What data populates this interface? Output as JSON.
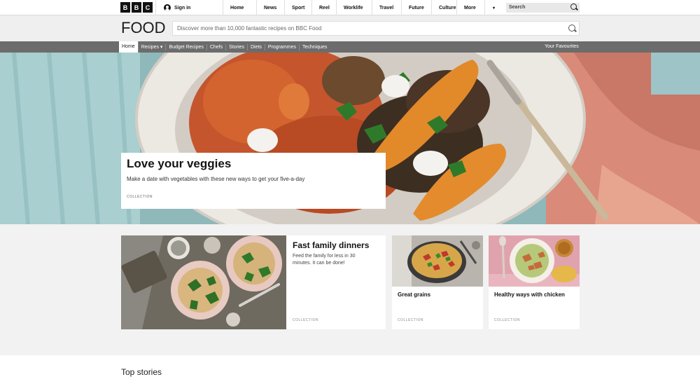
{
  "masthead": {
    "logo_letters": [
      "B",
      "B",
      "C"
    ],
    "signin": "Sign in",
    "nav": [
      "Home",
      "News",
      "Sport",
      "Reel",
      "Worklife",
      "Travel",
      "Future",
      "Culture",
      "More"
    ],
    "more_arrow": "▾",
    "search_placeholder": "Search"
  },
  "food_header": {
    "logo": "FOOD",
    "search_placeholder": "Discover more than 10,000 fantastic recipes on BBC Food"
  },
  "food_nav": {
    "items": [
      "Home",
      "Recipes ▾",
      "Budget Recipes",
      "Chefs",
      "Stories",
      "Diets",
      "Programmes",
      "Techniques"
    ],
    "favourites": "Your Favourites"
  },
  "hero": {
    "title": "Love your veggies",
    "description": "Make a date with vegetables with these new ways to get your five-a-day",
    "tag": "COLLECTION"
  },
  "cards": [
    {
      "title": "Fast family dinners",
      "description": "Feed the family for less in 30 minutes. It can be done!",
      "tag": "COLLECTION"
    },
    {
      "title": "Great grains",
      "tag": "COLLECTION"
    },
    {
      "title": "Healthy ways with chicken",
      "tag": "COLLECTION"
    }
  ],
  "section": {
    "title": "Top stories"
  }
}
